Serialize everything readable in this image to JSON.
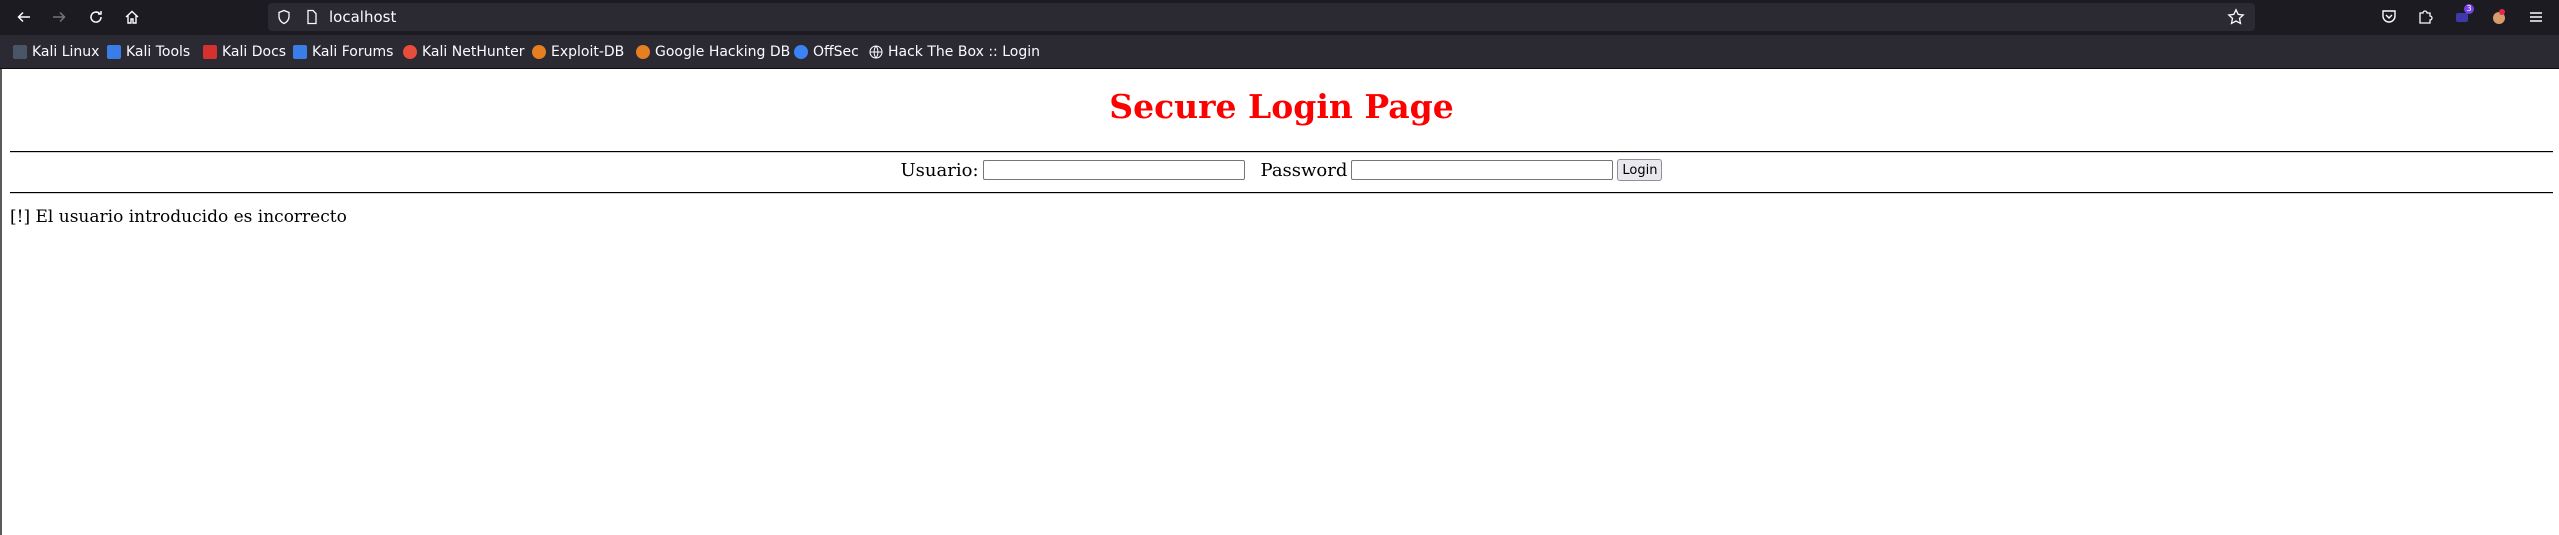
{
  "browser": {
    "url": "localhost",
    "extension_badge": "3"
  },
  "bookmarks": [
    {
      "label": "Kali Linux",
      "icon": "kali-dragon-icon",
      "color": "#4a5568"
    },
    {
      "label": "Kali Tools",
      "icon": "kali-tools-icon",
      "color": "#3b7de8"
    },
    {
      "label": "Kali Docs",
      "icon": "kali-docs-icon",
      "color": "#d63031"
    },
    {
      "label": "Kali Forums",
      "icon": "kali-forums-icon",
      "color": "#3b7de8"
    },
    {
      "label": "Kali NetHunter",
      "icon": "kali-nethunter-icon",
      "color": "#e74c3c"
    },
    {
      "label": "Exploit-DB",
      "icon": "exploit-db-icon",
      "color": "#e67e22"
    },
    {
      "label": "Google Hacking DB",
      "icon": "ghdb-icon",
      "color": "#e67e22"
    },
    {
      "label": "OffSec",
      "icon": "offsec-icon",
      "color": "#3b82f6"
    },
    {
      "label": "Hack The Box :: Login",
      "icon": "globe-icon",
      "color": "#fbfbfe"
    }
  ],
  "page": {
    "title": "Secure Login Page",
    "title_color": "#ff0000",
    "form": {
      "username_label": "Usuario:",
      "username_value": "",
      "password_label": "Password",
      "password_value": "",
      "submit_label": "Login"
    },
    "message": "[!] El usuario introducido es incorrecto"
  }
}
